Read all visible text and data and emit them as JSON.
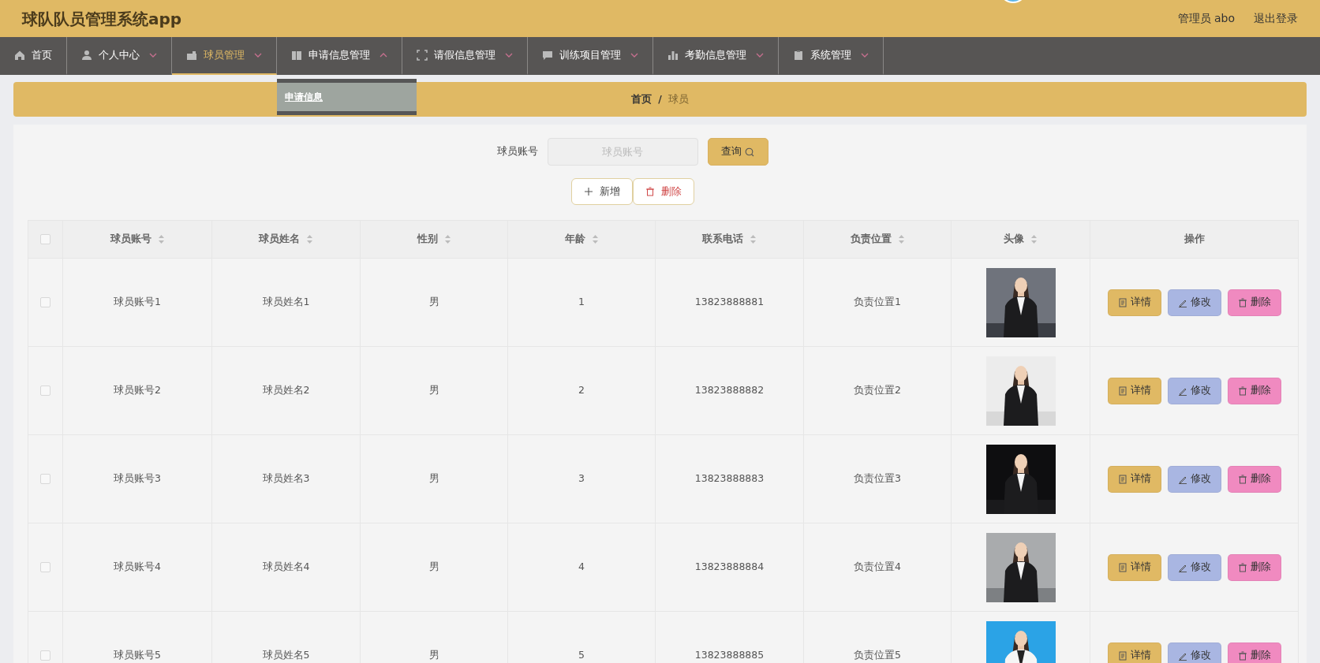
{
  "header": {
    "title": "球队队员管理系统app",
    "user": "管理员 abo",
    "logout": "退出登录"
  },
  "nav": [
    {
      "label": "首页",
      "selected": false,
      "has_menu": false
    },
    {
      "label": "个人中心",
      "selected": false,
      "has_menu": true,
      "expanded": false
    },
    {
      "label": "球员管理",
      "selected": true,
      "has_menu": true,
      "expanded": false
    },
    {
      "label": "申请信息管理",
      "selected": false,
      "has_menu": true,
      "expanded": true,
      "menu": [
        "申请信息"
      ]
    },
    {
      "label": "请假信息管理",
      "selected": false,
      "has_menu": true,
      "expanded": false
    },
    {
      "label": "训练项目管理",
      "selected": false,
      "has_menu": true,
      "expanded": false
    },
    {
      "label": "考勤信息管理",
      "selected": false,
      "has_menu": true,
      "expanded": false
    },
    {
      "label": "系统管理",
      "selected": false,
      "has_menu": true,
      "expanded": false
    }
  ],
  "breadcrumb": {
    "items": [
      {
        "label": "首页",
        "current": false
      },
      {
        "label": "球员",
        "current": true
      }
    ],
    "separator": "/"
  },
  "search": {
    "label": "球员账号",
    "placeholder": "球员账号",
    "button": "查询"
  },
  "actions": [
    {
      "label": "新增",
      "kind": "add"
    },
    {
      "label": "删除",
      "kind": "delete"
    }
  ],
  "table": {
    "select_all": {
      "checked": false
    },
    "columns": [
      {
        "label": "球员账号",
        "sortable": true
      },
      {
        "label": "球员姓名",
        "sortable": true
      },
      {
        "label": "性别",
        "sortable": true
      },
      {
        "label": "年龄",
        "sortable": true
      },
      {
        "label": "联系电话",
        "sortable": true
      },
      {
        "label": "负责位置",
        "sortable": true
      },
      {
        "label": "头像",
        "sortable": true
      },
      {
        "label": "操作",
        "sortable": false
      }
    ],
    "rows": [
      {
        "checked": false,
        "cells": [
          "球员账号1",
          "球员姓名1",
          "男",
          "1",
          "13823888881",
          "负责位置1"
        ],
        "actions": [
          {
            "label": "详情",
            "kind": "detail"
          },
          {
            "label": "修改",
            "kind": "edit"
          },
          {
            "label": "删除",
            "kind": "delete"
          }
        ]
      },
      {
        "checked": false,
        "cells": [
          "球员账号2",
          "球员姓名2",
          "男",
          "2",
          "13823888882",
          "负责位置2"
        ],
        "actions": [
          {
            "label": "详情",
            "kind": "detail"
          },
          {
            "label": "修改",
            "kind": "edit"
          },
          {
            "label": "删除",
            "kind": "delete"
          }
        ]
      },
      {
        "checked": false,
        "cells": [
          "球员账号3",
          "球员姓名3",
          "男",
          "3",
          "13823888883",
          "负责位置3"
        ],
        "actions": [
          {
            "label": "详情",
            "kind": "detail"
          },
          {
            "label": "修改",
            "kind": "edit"
          },
          {
            "label": "删除",
            "kind": "delete"
          }
        ]
      },
      {
        "checked": false,
        "cells": [
          "球员账号4",
          "球员姓名4",
          "男",
          "4",
          "13823888884",
          "负责位置4"
        ],
        "actions": [
          {
            "label": "详情",
            "kind": "detail"
          },
          {
            "label": "修改",
            "kind": "edit"
          },
          {
            "label": "删除",
            "kind": "delete"
          }
        ]
      },
      {
        "checked": false,
        "cells": [
          "球员账号5",
          "球员姓名5",
          "男",
          "5",
          "13823888885",
          "负责位置5"
        ],
        "actions": [
          {
            "label": "详情",
            "kind": "detail"
          },
          {
            "label": "修改",
            "kind": "edit"
          },
          {
            "label": "删除",
            "kind": "delete"
          }
        ]
      }
    ]
  }
}
